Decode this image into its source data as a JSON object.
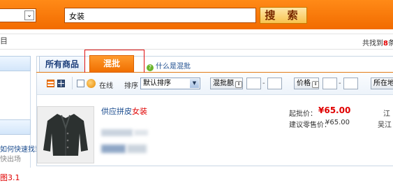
{
  "search": {
    "category_dropdown_arrow": "⌄",
    "query": "女装",
    "button_label": "搜 索"
  },
  "info": {
    "left_mark": "目",
    "found_prefix": "共找到",
    "found_count": "8",
    "found_suffix": "条"
  },
  "sidebar": {
    "link": "如何快速找到进来",
    "sub": "快出场"
  },
  "tabs": {
    "all": "所有商品",
    "mix": "混批",
    "help": "什么是混批",
    "help_icon": "?"
  },
  "toolbar": {
    "online_label": "在线",
    "sort_label": "排序",
    "sort_value": "默认排序",
    "mix_amount_label": "混批额",
    "price_label": "价格",
    "location_label": "所在地",
    "dash": "-"
  },
  "product": {
    "title_prefix": "供应拼皮",
    "title_keyword": "女装",
    "mix_price_label": "起批价：",
    "mix_price": "¥65.00",
    "retail_price_label": "建议零售价：",
    "retail_price": "¥65.00",
    "location_line1": "江",
    "location_line2": "吴江"
  },
  "caption": "图3.1",
  "colors": {
    "accent_orange": "#f26b00",
    "price_red": "#e00000",
    "link_blue": "#1a4b8e",
    "highlight_red": "#e01010"
  }
}
